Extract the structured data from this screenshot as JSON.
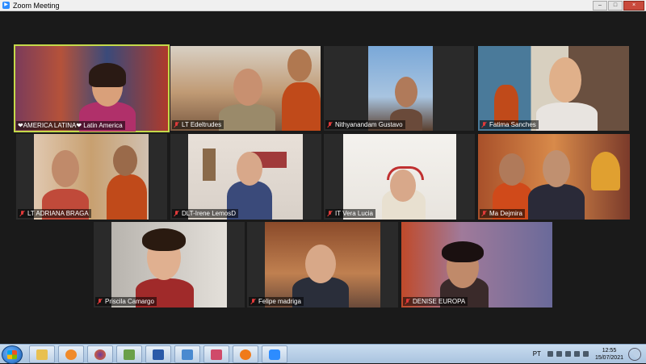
{
  "window": {
    "title": "Zoom Meeting",
    "minimize": "–",
    "maximize": "□",
    "close": "×"
  },
  "participants": [
    {
      "name": "❤AMERICA LATINA❤ Latin America",
      "muted": false,
      "active": true
    },
    {
      "name": "LT Edeltrudes",
      "muted": true,
      "active": false
    },
    {
      "name": "Nithyanandam Gustavo",
      "muted": true,
      "active": false
    },
    {
      "name": "Fatima Sanches",
      "muted": true,
      "active": false
    },
    {
      "name": "LT ADRIANA BRAGA",
      "muted": true,
      "active": false
    },
    {
      "name": "DLT-Irene LemosD",
      "muted": true,
      "active": false
    },
    {
      "name": "IT Vera Lucia",
      "muted": true,
      "active": false
    },
    {
      "name": "Ma Dejmira",
      "muted": true,
      "active": false
    },
    {
      "name": "Priscila Camargo",
      "muted": true,
      "active": false
    },
    {
      "name": "Felipe madriga",
      "muted": true,
      "active": false
    },
    {
      "name": "DENISE EUROPA",
      "muted": true,
      "active": false
    }
  ],
  "taskbar": {
    "apps": [
      "file-explorer",
      "media-player",
      "firefox",
      "paint-app",
      "word",
      "paint-brush",
      "snipping-tool",
      "avast",
      "zoom"
    ],
    "language": "PT",
    "time": "12:55",
    "date": "15/07/2021"
  },
  "colors": {
    "active_border": "#c4d94a",
    "mute_red": "#e03a3a",
    "background": "#1a1a1a"
  }
}
